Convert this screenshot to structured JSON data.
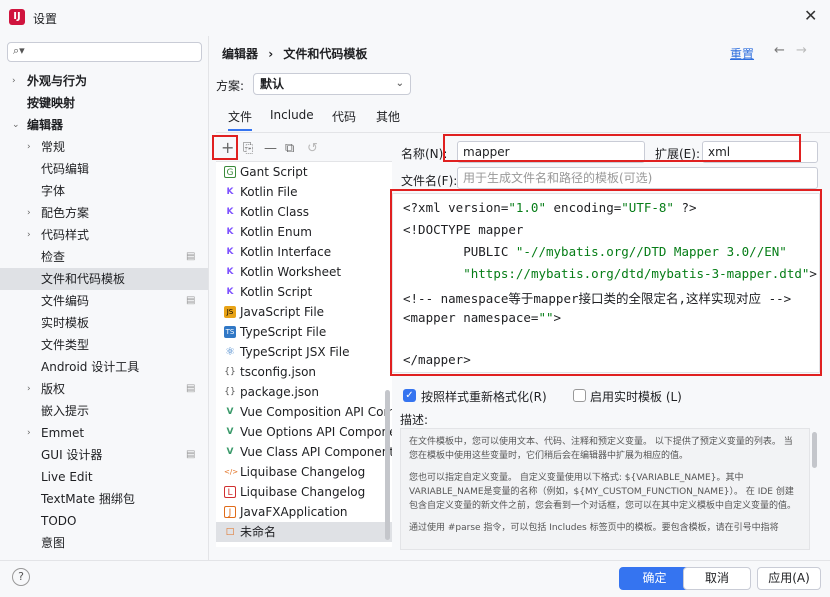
{
  "window": {
    "title": "设置"
  },
  "search": {
    "placeholder": ""
  },
  "sidebar": {
    "items": [
      {
        "label": "外观与行为"
      },
      {
        "label": "按键映射"
      },
      {
        "label": "编辑器"
      },
      {
        "label": "常规"
      },
      {
        "label": "代码编辑"
      },
      {
        "label": "字体"
      },
      {
        "label": "配色方案"
      },
      {
        "label": "代码样式"
      },
      {
        "label": "检查"
      },
      {
        "label": "文件和代码模板"
      },
      {
        "label": "文件编码"
      },
      {
        "label": "实时模板"
      },
      {
        "label": "文件类型"
      },
      {
        "label": "Android 设计工具"
      },
      {
        "label": "版权"
      },
      {
        "label": "嵌入提示"
      },
      {
        "label": "Emmet"
      },
      {
        "label": "GUI 设计器"
      },
      {
        "label": "Live Edit"
      },
      {
        "label": "TextMate 捆绑包"
      },
      {
        "label": "TODO"
      },
      {
        "label": "意图"
      }
    ]
  },
  "breadcrumb": {
    "root": "编辑器",
    "sep": "›",
    "current": "文件和代码模板"
  },
  "header": {
    "reset": "重置"
  },
  "scheme": {
    "label": "方案:",
    "value": "默认"
  },
  "tabs": [
    {
      "label": "文件"
    },
    {
      "label": "Include"
    },
    {
      "label": "代码"
    },
    {
      "label": "其他"
    }
  ],
  "toolbar": {
    "add": "+",
    "copy": "⎘",
    "remove": "—",
    "duplicate": "⧉",
    "revert": "↺"
  },
  "files": [
    {
      "name": "Gant Script",
      "icon": "G"
    },
    {
      "name": "Kotlin File",
      "icon": "K"
    },
    {
      "name": "Kotlin Class",
      "icon": "K"
    },
    {
      "name": "Kotlin Enum",
      "icon": "K"
    },
    {
      "name": "Kotlin Interface",
      "icon": "K"
    },
    {
      "name": "Kotlin Worksheet",
      "icon": "K"
    },
    {
      "name": "Kotlin Script",
      "icon": "K"
    },
    {
      "name": "JavaScript File",
      "icon": "JS"
    },
    {
      "name": "TypeScript File",
      "icon": "TS"
    },
    {
      "name": "TypeScript JSX File",
      "icon": "⚛"
    },
    {
      "name": "tsconfig.json",
      "icon": "{}"
    },
    {
      "name": "package.json",
      "icon": "{}"
    },
    {
      "name": "Vue Composition API Comp",
      "icon": "V"
    },
    {
      "name": "Vue Options API Componen",
      "icon": "V"
    },
    {
      "name": "Vue Class API Component",
      "icon": "V"
    },
    {
      "name": "Liquibase Changelog",
      "icon": "</>"
    },
    {
      "name": "Liquibase Changelog",
      "icon": "L"
    },
    {
      "name": "JavaFXApplication",
      "icon": "J"
    },
    {
      "name": "未命名",
      "icon": "□"
    }
  ],
  "form": {
    "name_label": "名称(N):",
    "name_value": "mapper",
    "ext_label": "扩展(E):",
    "ext_value": "xml",
    "filename_label": "文件名(F):",
    "filename_placeholder": "用于生成文件名和路径的模板(可选)"
  },
  "editor": {
    "lines": [
      {
        "a": "<?xml version=",
        "s": "\"1.0\"",
        "b": " encoding=",
        "s2": "\"UTF-8\"",
        "c": " ?>"
      },
      {
        "a": "<!DOCTYPE mapper"
      },
      {
        "a": "        PUBLIC ",
        "s": "\"-//mybatis.org//DTD Mapper 3.0//EN\""
      },
      {
        "a": "        ",
        "s": "\"https://mybatis.org/dtd/mybatis-3-mapper.dtd\"",
        "c": ">"
      },
      {
        "a": "<!-- namespace等于mapper接口类的全限定名,这样实现对应 -->"
      },
      {
        "a": "<mapper namespace=",
        "s": "\"\"",
        "c": ">"
      },
      {
        "a": ""
      },
      {
        "a": "</mapper>"
      }
    ]
  },
  "options": {
    "reformat": "按照样式重新格式化(R)",
    "live_templates": "启用实时模板 (L)"
  },
  "description": {
    "label": "描述:",
    "p1": "在文件模板中，您可以使用文本、代码、注释和预定义变量。 以下提供了预定义变量的列表。 当您在模板中使用这些变量时，它们稍后会在编辑器中扩展为相应的值。",
    "p2": "您也可以指定自定义变量。 自定义变量使用以下格式: ${VARIABLE_NAME}。其中 VARIABLE_NAME是变量的名称（例如，${MY_CUSTOM_FUNCTION_NAME}）。 在 IDE 创建包含自定义变量的新文件之前，您会看到一个对话框，您可以在其中定义模板中自定义变量的值。",
    "p3": "通过使用 #parse 指令，可以包括 Includes 标签页中的模板。要包含模板，请在引号中指将"
  },
  "footer": {
    "help": "?",
    "ok": "确定",
    "cancel": "取消",
    "apply": "应用(A)"
  }
}
